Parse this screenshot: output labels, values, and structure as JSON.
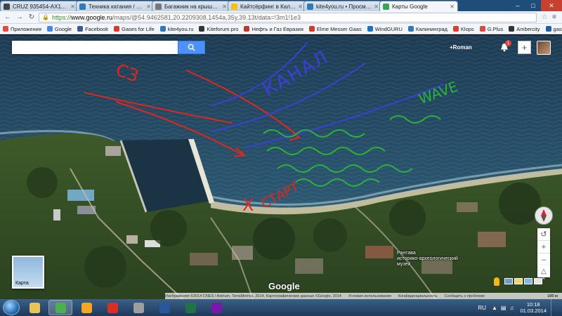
{
  "browser": {
    "tabs": [
      {
        "title": "CRUZ 935454-AX118 WW/",
        "color": "#444444"
      },
      {
        "title": "Техника катания / Kitefor",
        "color": "#2b7bbd"
      },
      {
        "title": "Багажник на крышу \"Lux",
        "color": "#777777"
      },
      {
        "title": "Кайтсёрфинг в Калинин",
        "color": "#f4c20d"
      },
      {
        "title": "kite4you.ru • Просмотр т",
        "color": "#2b7bbd"
      },
      {
        "title": "Карты Google",
        "color": "#34a853"
      }
    ],
    "url_scheme": "https://",
    "url_host": "www.google.ru",
    "url_rest": "/maps/@54.9462581,20.2209308,1454a,35y,39.13t/data=!3m1!1e3"
  },
  "bookmarks": [
    {
      "label": "Приложения",
      "color": "#e34b3c"
    },
    {
      "label": "Google",
      "color": "#4285f4"
    },
    {
      "label": "Facebook",
      "color": "#3b5998"
    },
    {
      "label": "Gases for Life",
      "color": "#d33b2c"
    },
    {
      "label": "kite4you.ru",
      "color": "#2b7bbd"
    },
    {
      "label": "Kiteforum.pro",
      "color": "#333333"
    },
    {
      "label": "Нефть и Газ Евразия",
      "color": "#c0392b"
    },
    {
      "label": "Elme Messer Gaas",
      "color": "#d33b2c"
    },
    {
      "label": "WindGURU",
      "color": "#1a73c8"
    },
    {
      "label": "Калининград",
      "color": "#2b7bbd"
    },
    {
      "label": "Klops",
      "color": "#e03d2f"
    },
    {
      "label": "G.Plus",
      "color": "#dd4b39"
    },
    {
      "label": "Ambercity",
      "color": "#333333"
    },
    {
      "label": "gasworld",
      "color": "#1f5fa8"
    }
  ],
  "map": {
    "search_placeholder": "",
    "user_label": "+Roman",
    "notification_count": "1",
    "thumbnail_label": "Карта",
    "poi_label": "Рантава\nисторико-археологический\nмузей",
    "google_logo": "Google",
    "footer": {
      "attribution": "Изображения ©2014 CNES / Astrium, TerraMetrics, 2014, Картографические данные ©Google, 2014",
      "terms": "Условия использования",
      "privacy": "Конфиденциальность",
      "report": "Сообщить о проблеме",
      "scale": "100 м"
    },
    "annotations": {
      "wind": "СЗ",
      "channel": "КАНАЛ",
      "wave": "WAVE",
      "start": "СТАРТ",
      "start_mark": "Х"
    }
  },
  "taskbar": {
    "apps": [
      {
        "name": "explorer",
        "color": "#e8c25a"
      },
      {
        "name": "chrome",
        "color": "#4caf50"
      },
      {
        "name": "outlook",
        "color": "#f5a623"
      },
      {
        "name": "gmail",
        "color": "#d93025"
      },
      {
        "name": "apps",
        "color": "#9e9e9e"
      },
      {
        "name": "word",
        "color": "#2b579a"
      },
      {
        "name": "excel",
        "color": "#217346"
      },
      {
        "name": "onenote",
        "color": "#7719aa"
      }
    ],
    "lang": "RU",
    "time": "10:18",
    "date": "01.03.2014"
  }
}
